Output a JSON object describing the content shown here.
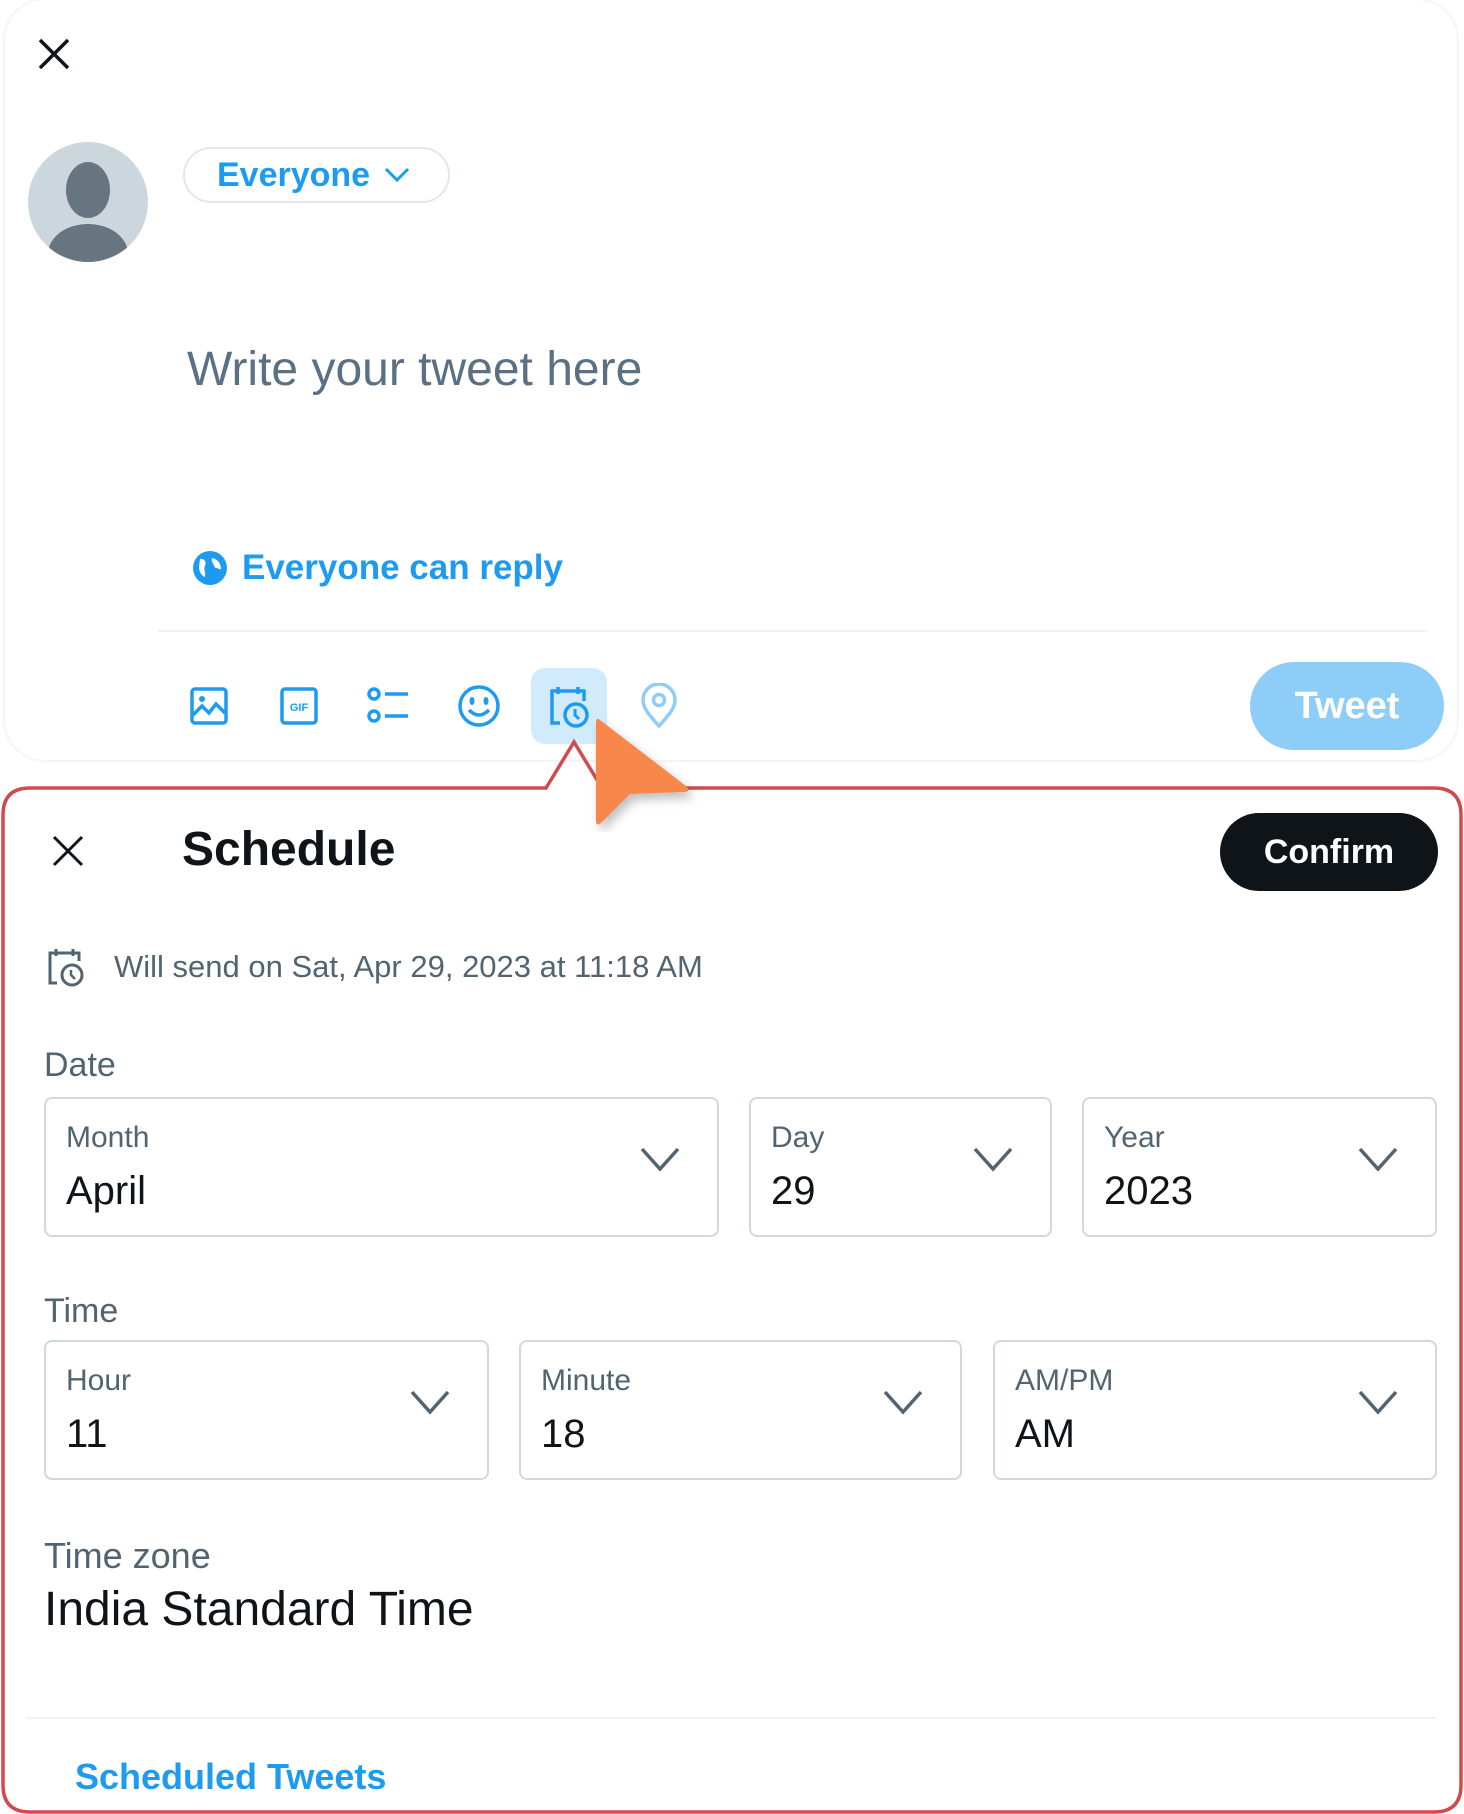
{
  "compose": {
    "audience_label": "Everyone",
    "tweet_placeholder": "Write your tweet here",
    "reply_setting_label": "Everyone can reply",
    "toolbar_icons": [
      "image-icon",
      "gif-icon",
      "poll-icon",
      "emoji-icon",
      "schedule-icon",
      "location-icon"
    ],
    "active_tool": "schedule-icon",
    "gif_glyph": "GIF",
    "tweet_button_label": "Tweet"
  },
  "schedule": {
    "title": "Schedule",
    "confirm_label": "Confirm",
    "will_send_text": "Will send on Sat, Apr 29, 2023 at 11:18 AM",
    "date_section_label": "Date",
    "date_fields": [
      {
        "label": "Month",
        "value": "April"
      },
      {
        "label": "Day",
        "value": "29"
      },
      {
        "label": "Year",
        "value": "2023"
      }
    ],
    "time_section_label": "Time",
    "time_fields": [
      {
        "label": "Hour",
        "value": "11"
      },
      {
        "label": "Minute",
        "value": "18"
      },
      {
        "label": "AM/PM",
        "value": "AM"
      }
    ],
    "timezone_label": "Time zone",
    "timezone_value": "India Standard Time",
    "scheduled_tweets_link": "Scheduled Tweets"
  },
  "colors": {
    "accent": "#1d9bf0",
    "tweet_button_disabled": "#8ecdf8",
    "callout_border": "#d14b4e",
    "cursor": "#f7874b",
    "confirm_bg": "#0f1419"
  }
}
